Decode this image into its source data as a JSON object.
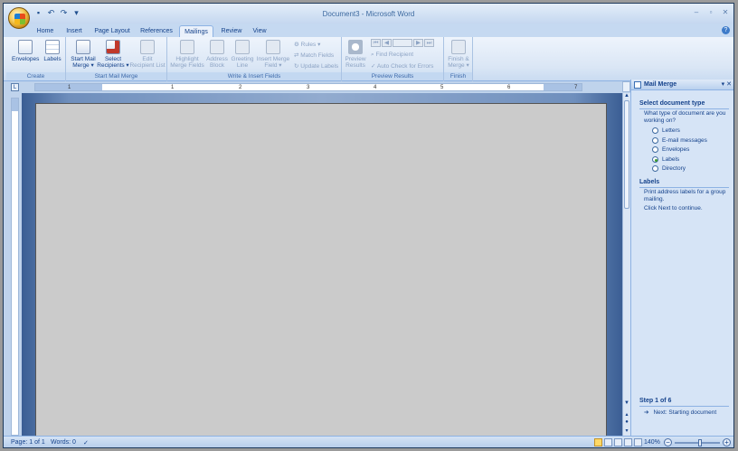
{
  "window": {
    "title": "Document3 - Microsoft Word"
  },
  "qat": {
    "icons": [
      "save-icon",
      "undo-icon",
      "redo-icon",
      "customize-icon"
    ]
  },
  "tabs": [
    {
      "label": "Home"
    },
    {
      "label": "Insert"
    },
    {
      "label": "Page Layout"
    },
    {
      "label": "References"
    },
    {
      "label": "Mailings"
    },
    {
      "label": "Review"
    },
    {
      "label": "View"
    }
  ],
  "active_tab": "Mailings",
  "ribbon": {
    "create": {
      "label": "Create",
      "envelopes": "Envelopes",
      "labels": "Labels"
    },
    "start": {
      "label": "Start Mail Merge",
      "start_line1": "Start Mail",
      "start_line2": "Merge ▾",
      "select_line1": "Select",
      "select_line2": "Recipients ▾",
      "edit_line1": "Edit",
      "edit_line2": "Recipient List"
    },
    "write": {
      "label": "Write & Insert Fields",
      "highlight_line1": "Highlight",
      "highlight_line2": "Merge Fields",
      "address_line1": "Address",
      "address_line2": "Block",
      "greeting_line1": "Greeting",
      "greeting_line2": "Line",
      "insert_line1": "Insert Merge",
      "insert_line2": "Field ▾",
      "rules": "Rules ▾",
      "match": "Match Fields",
      "update": "Update Labels"
    },
    "preview": {
      "label": "Preview Results",
      "preview_line1": "Preview",
      "preview_line2": "Results",
      "find": "Find Recipient",
      "autocheck": "Auto Check for Errors"
    },
    "finish": {
      "label": "Finish",
      "finish_line1": "Finish &",
      "finish_line2": "Merge ▾"
    }
  },
  "ruler": {
    "numbers": [
      "1",
      "1",
      "2",
      "3",
      "4",
      "5",
      "6",
      "7"
    ]
  },
  "pane": {
    "title": "Mail Merge",
    "section1": "Select document type",
    "question": "What type of document are you working on?",
    "options": [
      {
        "label": "Letters",
        "selected": false
      },
      {
        "label": "E-mail messages",
        "selected": false
      },
      {
        "label": "Envelopes",
        "selected": false
      },
      {
        "label": "Labels",
        "selected": true
      },
      {
        "label": "Directory",
        "selected": false
      }
    ],
    "section2": "Labels",
    "desc": "Print address labels for a group mailing.",
    "click_next": "Click Next to continue.",
    "step": "Step 1 of 6",
    "next": "Next: Starting document"
  },
  "status": {
    "page": "Page: 1 of 1",
    "words": "Words: 0",
    "zoom": "140%"
  }
}
